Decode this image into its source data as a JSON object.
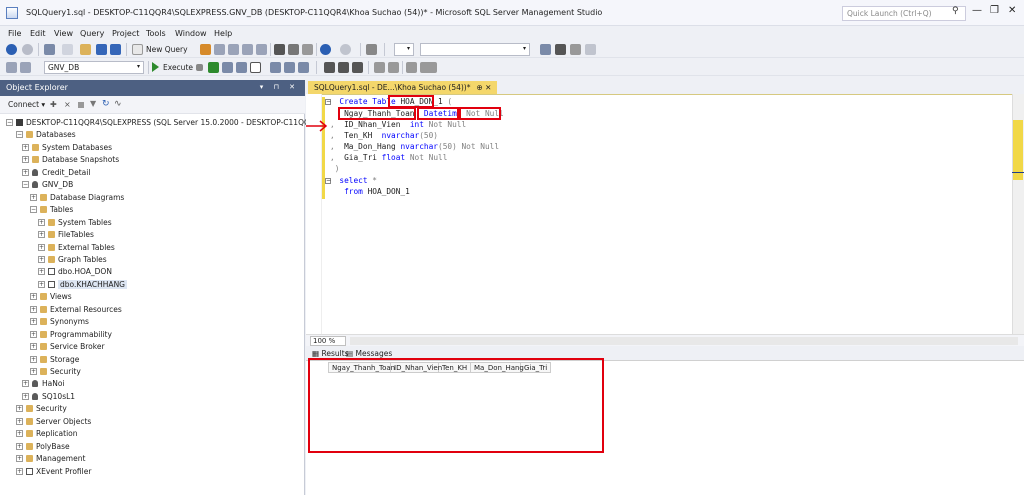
{
  "window": {
    "title": "SQLQuery1.sql - DESKTOP-C11QQR4\\SQLEXPRESS.GNV_DB (DESKTOP-C11QQR4\\Khoa Suchao (54))* - Microsoft SQL Server Management Studio",
    "quick_launch_placeholder": "Quick Launch (Ctrl+Q)",
    "controls": [
      "—",
      "❐",
      "✕"
    ]
  },
  "menu": [
    "File",
    "Edit",
    "View",
    "Query",
    "Project",
    "Tools",
    "Window",
    "Help"
  ],
  "toolbar1": {
    "new_query": "New Query"
  },
  "toolbar2": {
    "database": "GNV_DB",
    "execute": "Execute"
  },
  "object_explorer": {
    "title": "Object Explorer",
    "header_controls": "▾ ⊓ ✕",
    "connect_label": "Connect ▾",
    "tree": [
      {
        "label": "DESKTOP-C11QQR4\\SQLEXPRESS (SQL Server 15.0.2000 - DESKTOP-C11QQR4\\Khoa Suchao)",
        "exp": "−",
        "icon": "server"
      },
      {
        "label": "Databases",
        "exp": "−",
        "icon": "folder"
      },
      {
        "label": "System Databases",
        "exp": "+",
        "icon": "folder"
      },
      {
        "label": "Database Snapshots",
        "exp": "+",
        "icon": "folder"
      },
      {
        "label": "Credit_Detail",
        "exp": "+",
        "icon": "db"
      },
      {
        "label": "GNV_DB",
        "exp": "−",
        "icon": "db"
      },
      {
        "label": "Database Diagrams",
        "exp": "+",
        "icon": "folder"
      },
      {
        "label": "Tables",
        "exp": "−",
        "icon": "folder"
      },
      {
        "label": "System Tables",
        "exp": "+",
        "icon": "folder"
      },
      {
        "label": "FileTables",
        "exp": "+",
        "icon": "folder"
      },
      {
        "label": "External Tables",
        "exp": "+",
        "icon": "folder"
      },
      {
        "label": "Graph Tables",
        "exp": "+",
        "icon": "folder"
      },
      {
        "label": "dbo.HOA_DON",
        "exp": "+",
        "icon": "table"
      },
      {
        "label": "dbo.KHACHHANG",
        "exp": "+",
        "icon": "table"
      },
      {
        "label": "Views",
        "exp": "+",
        "icon": "folder"
      },
      {
        "label": "External Resources",
        "exp": "+",
        "icon": "folder"
      },
      {
        "label": "Synonyms",
        "exp": "+",
        "icon": "folder"
      },
      {
        "label": "Programmability",
        "exp": "+",
        "icon": "folder"
      },
      {
        "label": "Service Broker",
        "exp": "+",
        "icon": "folder"
      },
      {
        "label": "Storage",
        "exp": "+",
        "icon": "folder"
      },
      {
        "label": "Security",
        "exp": "+",
        "icon": "folder"
      },
      {
        "label": "HaNoi",
        "exp": "+",
        "icon": "db"
      },
      {
        "label": "SQ10sL1",
        "exp": "+",
        "icon": "db"
      },
      {
        "label": "Security",
        "exp": "+",
        "icon": "folder"
      },
      {
        "label": "Server Objects",
        "exp": "+",
        "icon": "folder"
      },
      {
        "label": "Replication",
        "exp": "+",
        "icon": "folder"
      },
      {
        "label": "PolyBase",
        "exp": "+",
        "icon": "folder"
      },
      {
        "label": "Management",
        "exp": "+",
        "icon": "folder"
      },
      {
        "label": "XEvent Profiler",
        "exp": "+",
        "icon": "table"
      }
    ]
  },
  "editor": {
    "tab_label": "SQLQuery1.sql - DE...\\Khoa Suchao (54))*",
    "tab_pin": "⊕ ✕",
    "zoom": "100 %",
    "code": {
      "l1_kw": "Create Table",
      "l1_name": "HOA_DON_1",
      "l1_paren": "(",
      "l2_col": "Ngay_Thanh_Toan",
      "l2_type": "Datetime",
      "l2_null": "Not Null",
      "l3_comma": ",",
      "l3_col": "ID_Nhan_Vien",
      "l3_type": "int",
      "l3_null": "Not Null",
      "l4_comma": ",",
      "l4_col": "Ten_KH",
      "l4_type": "nvarchar",
      "l4_args": "(50)",
      "l5_comma": ",",
      "l5_col": "Ma_Don_Hang",
      "l5_type": "nvarchar",
      "l5_args": "(50)",
      "l5_null": "Not Null",
      "l6_comma": ",",
      "l6_col": "Gia_Tri",
      "l6_type": "float",
      "l6_null": "Not Null",
      "l7": ")",
      "l8_kw": "select",
      "l8_star": "*",
      "l9_kw": "from",
      "l9_name": "HOA_DON_1"
    }
  },
  "results": {
    "tabs": [
      "Results",
      "Messages"
    ],
    "columns": [
      "Ngay_Thanh_Toan",
      "ID_Nhan_Vien",
      "Ten_KH",
      "Ma_Don_Hang",
      "Gia_Tri"
    ]
  },
  "colors": {
    "accent_red": "#e1000e",
    "tab_yellow": "#f4d76b",
    "oe_header": "#4d6082",
    "keyword_blue": "#0000ff"
  }
}
